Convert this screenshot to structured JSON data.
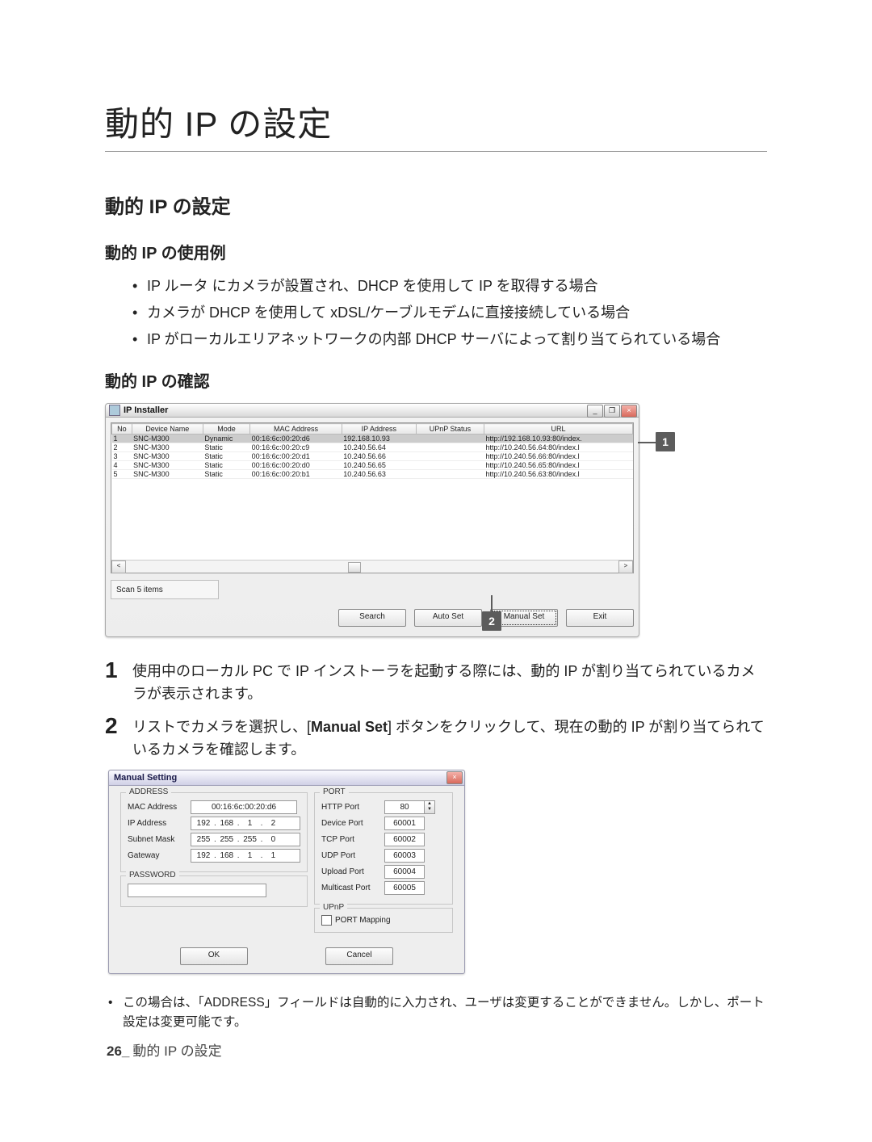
{
  "title": "動的 IP の設定",
  "h2": "動的 IP の設定",
  "sections": {
    "usage_title": "動的 IP の使用例",
    "check_title": "動的 IP の確認"
  },
  "bullets": [
    "IP ルータ にカメラが設置され、DHCP を使用して IP を取得する場合",
    "カメラが DHCP を使用して xDSL/ケーブルモデムに直接接続している場合",
    "IP がローカルエリアネットワークの内部 DHCP サーバによって割り当てられている場合"
  ],
  "ip_installer": {
    "title": "IP Installer",
    "win_min": "_",
    "win_max": "❐",
    "win_close": "×",
    "columns": [
      "No",
      "Device Name",
      "Mode",
      "MAC Address",
      "IP Address",
      "UPnP Status",
      "URL"
    ],
    "rows": [
      {
        "no": "1",
        "name": "SNC-M300",
        "mode": "Dynamic",
        "mac": "00:16:6c:00:20:d6",
        "ip": "192.168.10.93",
        "upnp": "",
        "url": "http://192.168.10.93:80/index.",
        "sel": true
      },
      {
        "no": "2",
        "name": "SNC-M300",
        "mode": "Static",
        "mac": "00:16:6c:00:20:c9",
        "ip": "10.240.56.64",
        "upnp": "",
        "url": "http://10.240.56.64:80/index.l",
        "sel": false
      },
      {
        "no": "3",
        "name": "SNC-M300",
        "mode": "Static",
        "mac": "00:16:6c:00:20:d1",
        "ip": "10.240.56.66",
        "upnp": "",
        "url": "http://10.240.56.66:80/index.l",
        "sel": false
      },
      {
        "no": "4",
        "name": "SNC-M300",
        "mode": "Static",
        "mac": "00:16:6c:00:20:d0",
        "ip": "10.240.56.65",
        "upnp": "",
        "url": "http://10.240.56.65:80/index.l",
        "sel": false
      },
      {
        "no": "5",
        "name": "SNC-M300",
        "mode": "Static",
        "mac": "00:16:6c:00:20:b1",
        "ip": "10.240.56.63",
        "upnp": "",
        "url": "http://10.240.56.63:80/index.l",
        "sel": false
      }
    ],
    "scan": "Scan 5 items",
    "scroll_left": "<",
    "scroll_right": ">",
    "buttons": {
      "search": "Search",
      "auto": "Auto Set",
      "manual": "Manual Set",
      "exit": "Exit"
    }
  },
  "callouts": {
    "one": "1",
    "two": "2"
  },
  "steps": {
    "s1_num": "1",
    "s1": "使用中のローカル PC で IP インストーラを起動する際には、動的 IP が割り当てられているカメラが表示されます。",
    "s2_num": "2",
    "s2_a": "リストでカメラを選択し、[",
    "s2_b": "Manual Set",
    "s2_c": "] ボタンをクリックして、現在の動的 IP が割り当てられているカメラを確認します。"
  },
  "manual": {
    "title": "Manual Setting",
    "win_close": "×",
    "address": {
      "legend": "ADDRESS",
      "mac_label": "MAC Address",
      "mac": "00:16:6c:00:20:d6",
      "ip_label": "IP Address",
      "ip": [
        "192",
        "168",
        "1",
        "2"
      ],
      "subnet_label": "Subnet Mask",
      "subnet": [
        "255",
        "255",
        "255",
        "0"
      ],
      "gateway_label": "Gateway",
      "gateway": [
        "192",
        "168",
        "1",
        "1"
      ]
    },
    "password": {
      "legend": "PASSWORD",
      "value": ""
    },
    "port": {
      "legend": "PORT",
      "http": "HTTP Port",
      "http_v": "80",
      "device": "Device Port",
      "device_v": "60001",
      "tcp": "TCP Port",
      "tcp_v": "60002",
      "udp": "UDP Port",
      "udp_v": "60003",
      "upload": "Upload Port",
      "upload_v": "60004",
      "multicast": "Multicast Port",
      "multicast_v": "60005"
    },
    "upnp": {
      "legend": "UPnP",
      "map": "PORT Mapping"
    },
    "ok": "OK",
    "cancel": "Cancel"
  },
  "note": "この場合は、「ADDRESS」フィールドは自動的に入力され、ユーザは変更することができません。しかし、ポート設定は変更可能です。",
  "footer": {
    "page": "26_",
    "section": "動的 IP の設定"
  }
}
